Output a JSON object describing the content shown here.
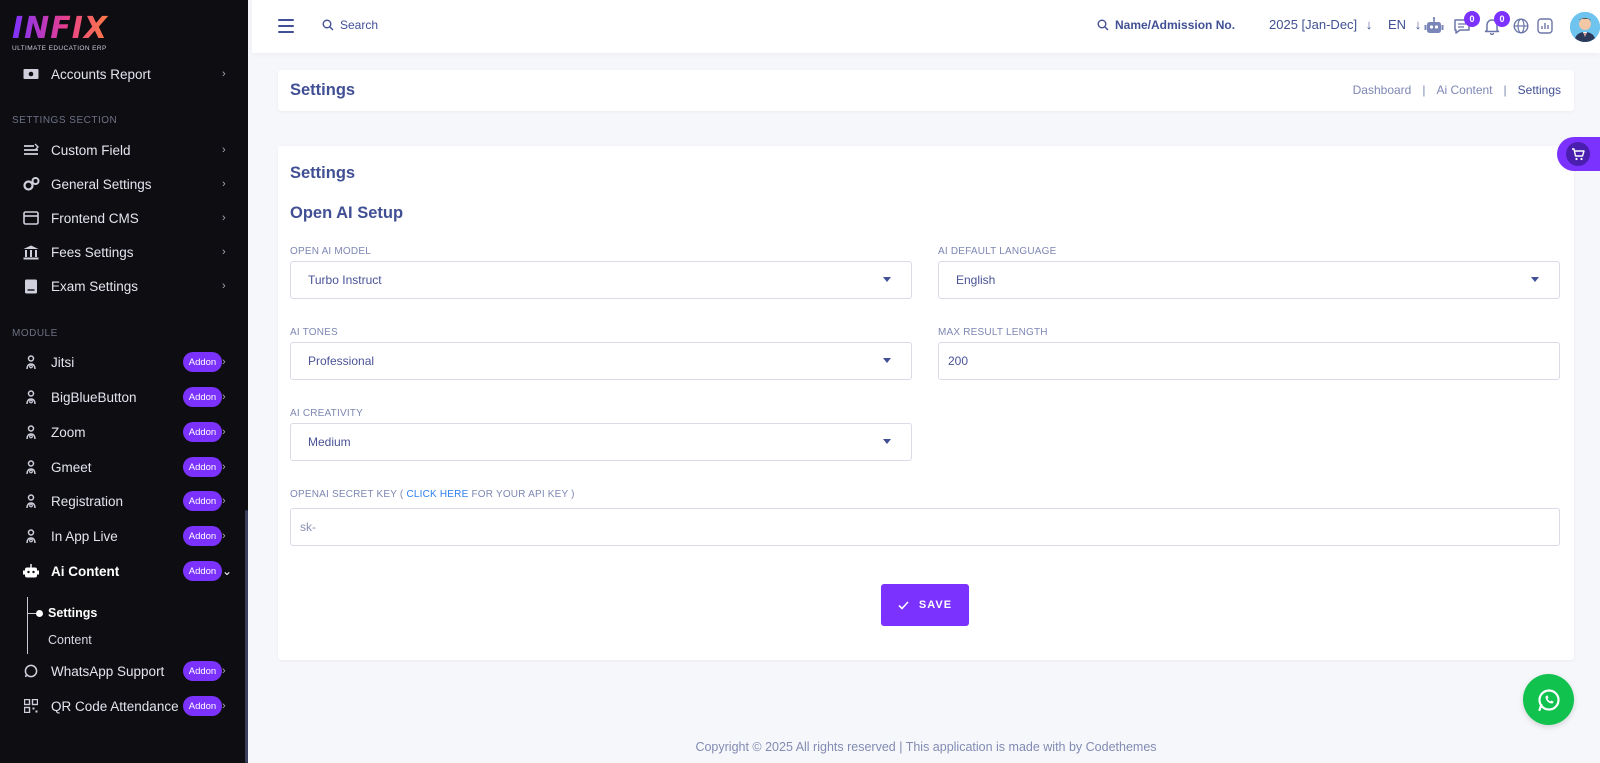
{
  "brand": {
    "logo_text": "INFIX",
    "logo_subtitle": "ULTIMATE EDUCATION ERP"
  },
  "sidebar": {
    "top_item": {
      "label": "Accounts Report",
      "icon": "accounts-report-icon"
    },
    "settings_section_label": "SETTINGS SECTION",
    "settings_items": [
      {
        "label": "Custom Field",
        "icon": "custom-field-icon"
      },
      {
        "label": "General Settings",
        "icon": "general-settings-icon"
      },
      {
        "label": "Frontend CMS",
        "icon": "frontend-cms-icon"
      },
      {
        "label": "Fees Settings",
        "icon": "fees-settings-icon"
      },
      {
        "label": "Exam Settings",
        "icon": "exam-settings-icon"
      }
    ],
    "module_label": "MODULE",
    "addon_badge": "Addon",
    "module_items": [
      {
        "label": "Jitsi",
        "icon": "person-icon"
      },
      {
        "label": "BigBlueButton",
        "icon": "person-icon"
      },
      {
        "label": "Zoom",
        "icon": "person-icon"
      },
      {
        "label": "Gmeet",
        "icon": "person-icon"
      },
      {
        "label": "Registration",
        "icon": "person-icon"
      },
      {
        "label": "In App Live",
        "icon": "person-icon"
      },
      {
        "label": "Ai Content",
        "icon": "robot-icon"
      }
    ],
    "ai_subitems": [
      {
        "label": "Settings"
      },
      {
        "label": "Content"
      }
    ],
    "after_items": [
      {
        "label": "WhatsApp Support",
        "icon": "whatsapp-icon"
      },
      {
        "label": "QR Code Attendance",
        "icon": "qr-code-icon"
      }
    ]
  },
  "topbar": {
    "search_label": "Search",
    "student_search_label": "Name/Admission No.",
    "academic_year": "2025 [Jan-Dec]",
    "language": "EN",
    "chat_count": "0",
    "notification_count": "0"
  },
  "breadcrumb": {
    "title": "Settings",
    "trail": [
      "Dashboard",
      "Ai Content",
      "Settings"
    ],
    "separator": "|"
  },
  "form": {
    "card_title": "Settings",
    "section_title": "Open AI Setup",
    "model": {
      "label": "OPEN AI MODEL",
      "value": "Turbo Instruct"
    },
    "language": {
      "label": "AI DEFAULT LANGUAGE",
      "value": "English"
    },
    "tones": {
      "label": "AI TONES",
      "value": "Professional"
    },
    "max_length": {
      "label": "MAX RESULT LENGTH",
      "value": "200"
    },
    "creativity": {
      "label": "AI CREATIVITY",
      "value": "Medium"
    },
    "secret_key": {
      "label_prefix": "OPENAI SECRET KEY (",
      "link_text": "CLICK HERE",
      "label_suffix": "FOR YOUR API KEY )",
      "placeholder": "sk-"
    },
    "save_label": "SAVE"
  },
  "footer": {
    "text": "Copyright © 2025 All rights reserved | This application is made with by Codethemes"
  },
  "colors": {
    "accent": "#7c32ff",
    "sidebar_bg": "#0d0d12",
    "text_primary": "#415094",
    "whatsapp": "#12c24f"
  }
}
